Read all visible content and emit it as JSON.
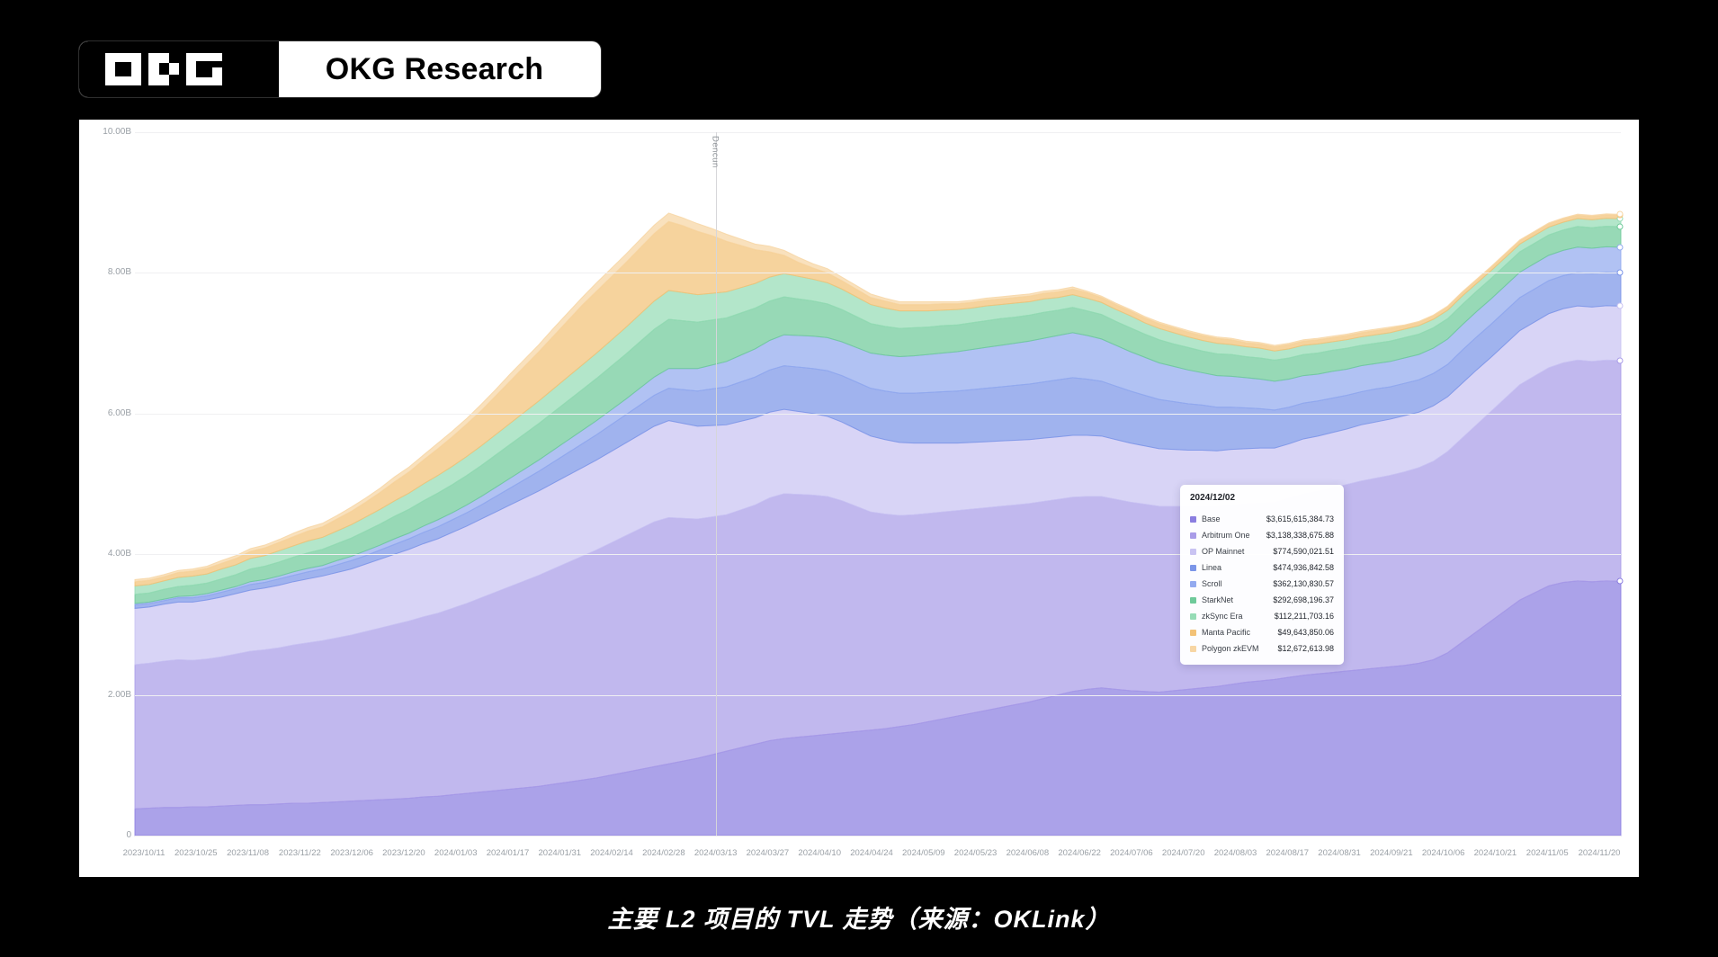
{
  "brand": {
    "logo_icon": "okg-logo-icon",
    "title": "OKG Research"
  },
  "caption": "主要 L2 项目的 TVL 走势（来源：OKLink）",
  "tooltip": {
    "date": "2024/12/02",
    "rows": [
      {
        "name": "Base",
        "value": "$3,615,615,384.73",
        "color": "#8b7ee0"
      },
      {
        "name": "Arbitrum One",
        "value": "$3,138,338,675.88",
        "color": "#a99ce8"
      },
      {
        "name": "OP Mainnet",
        "value": "$774,590,021.51",
        "color": "#c9c3f2"
      },
      {
        "name": "Linea",
        "value": "$474,936,842.58",
        "color": "#7b95e8"
      },
      {
        "name": "Scroll",
        "value": "$362,130,830.57",
        "color": "#93aaef"
      },
      {
        "name": "StarkNet",
        "value": "$292,698,196.37",
        "color": "#6fca9a"
      },
      {
        "name": "zkSync Era",
        "value": "$112,211,703.16",
        "color": "#96dcb6"
      },
      {
        "name": "Manta Pacific",
        "value": "$49,643,850.06",
        "color": "#f3c277"
      },
      {
        "name": "Polygon zkEVM",
        "value": "$12,672,613.98",
        "color": "#f7d6a4"
      }
    ]
  },
  "annotation": {
    "label": "Dencun"
  },
  "chart_data": {
    "type": "area",
    "stacked": true,
    "title": "",
    "xlabel": "",
    "ylabel": "",
    "ylim": [
      0,
      10000000000
    ],
    "grid": true,
    "legend_position": "tooltip",
    "y_ticks": [
      "0",
      "2.00B",
      "4.00B",
      "6.00B",
      "8.00B",
      "10.00B"
    ],
    "y_tick_values": [
      0,
      2000000000,
      4000000000,
      6000000000,
      8000000000,
      10000000000
    ],
    "x_ticks": [
      "2023/10/11",
      "2023/10/25",
      "2023/11/08",
      "2023/11/22",
      "2023/12/06",
      "2023/12/20",
      "2024/01/03",
      "2024/01/17",
      "2024/01/31",
      "2024/02/14",
      "2024/02/28",
      "2024/03/13",
      "2024/03/27",
      "2024/04/10",
      "2024/04/24",
      "2024/05/09",
      "2024/05/23",
      "2024/06/08",
      "2024/06/22",
      "2024/07/06",
      "2024/07/20",
      "2024/08/03",
      "2024/08/17",
      "2024/08/31",
      "2024/09/21",
      "2024/10/06",
      "2024/10/21",
      "2024/11/05",
      "2024/11/20"
    ],
    "annotations": [
      {
        "label": "Dencun",
        "x": "2024/03/13",
        "type": "vertical-line"
      }
    ],
    "series": [
      {
        "name": "Base",
        "color": "#8b7ee0",
        "values": [
          0.38,
          0.39,
          0.4,
          0.4,
          0.41,
          0.41,
          0.42,
          0.43,
          0.44,
          0.44,
          0.45,
          0.46,
          0.46,
          0.47,
          0.48,
          0.49,
          0.5,
          0.51,
          0.52,
          0.53,
          0.55,
          0.56,
          0.58,
          0.6,
          0.62,
          0.64,
          0.66,
          0.68,
          0.7,
          0.73,
          0.76,
          0.79,
          0.82,
          0.86,
          0.9,
          0.94,
          0.98,
          1.02,
          1.06,
          1.1,
          1.15,
          1.2,
          1.25,
          1.3,
          1.35,
          1.38,
          1.4,
          1.42,
          1.44,
          1.46,
          1.48,
          1.5,
          1.52,
          1.55,
          1.58,
          1.62,
          1.66,
          1.7,
          1.74,
          1.78,
          1.82,
          1.86,
          1.9,
          1.95,
          2.0,
          2.05,
          2.08,
          2.1,
          2.08,
          2.06,
          2.05,
          2.04,
          2.06,
          2.08,
          2.1,
          2.12,
          2.15,
          2.18,
          2.2,
          2.22,
          2.25,
          2.28,
          2.3,
          2.32,
          2.34,
          2.36,
          2.38,
          2.4,
          2.42,
          2.45,
          2.5,
          2.6,
          2.75,
          2.9,
          3.05,
          3.2,
          3.35,
          3.45,
          3.55,
          3.6,
          3.62,
          3.61,
          3.62,
          3.615
        ]
      },
      {
        "name": "Arbitrum One",
        "color": "#a99ce8",
        "values": [
          2.05,
          2.06,
          2.08,
          2.1,
          2.08,
          2.1,
          2.12,
          2.15,
          2.18,
          2.2,
          2.22,
          2.25,
          2.28,
          2.3,
          2.33,
          2.36,
          2.4,
          2.44,
          2.48,
          2.52,
          2.56,
          2.6,
          2.65,
          2.7,
          2.76,
          2.82,
          2.88,
          2.94,
          3.0,
          3.06,
          3.12,
          3.18,
          3.24,
          3.3,
          3.36,
          3.42,
          3.48,
          3.5,
          3.45,
          3.4,
          3.38,
          3.36,
          3.38,
          3.4,
          3.45,
          3.48,
          3.45,
          3.42,
          3.38,
          3.3,
          3.2,
          3.1,
          3.05,
          3.0,
          2.98,
          2.96,
          2.94,
          2.92,
          2.9,
          2.88,
          2.86,
          2.84,
          2.82,
          2.8,
          2.78,
          2.76,
          2.74,
          2.72,
          2.7,
          2.68,
          2.66,
          2.64,
          2.62,
          2.6,
          2.58,
          2.56,
          2.55,
          2.54,
          2.53,
          2.52,
          2.55,
          2.58,
          2.6,
          2.62,
          2.65,
          2.68,
          2.7,
          2.72,
          2.75,
          2.78,
          2.82,
          2.86,
          2.9,
          2.94,
          2.98,
          3.02,
          3.06,
          3.08,
          3.1,
          3.12,
          3.14,
          3.13,
          3.14,
          3.138
        ]
      },
      {
        "name": "OP Mainnet",
        "color": "#c9c3f2",
        "values": [
          0.8,
          0.8,
          0.81,
          0.82,
          0.83,
          0.84,
          0.85,
          0.86,
          0.87,
          0.88,
          0.89,
          0.9,
          0.91,
          0.92,
          0.93,
          0.94,
          0.96,
          0.98,
          1.0,
          1.02,
          1.04,
          1.06,
          1.08,
          1.1,
          1.12,
          1.14,
          1.16,
          1.18,
          1.2,
          1.22,
          1.24,
          1.26,
          1.28,
          1.3,
          1.32,
          1.34,
          1.36,
          1.38,
          1.35,
          1.32,
          1.3,
          1.28,
          1.26,
          1.24,
          1.22,
          1.2,
          1.18,
          1.16,
          1.14,
          1.12,
          1.1,
          1.08,
          1.06,
          1.04,
          1.02,
          1.0,
          0.98,
          0.96,
          0.95,
          0.94,
          0.93,
          0.92,
          0.91,
          0.9,
          0.89,
          0.88,
          0.87,
          0.86,
          0.85,
          0.84,
          0.83,
          0.82,
          0.81,
          0.8,
          0.8,
          0.79,
          0.79,
          0.78,
          0.78,
          0.77,
          0.77,
          0.78,
          0.78,
          0.79,
          0.79,
          0.8,
          0.8,
          0.8,
          0.8,
          0.79,
          0.79,
          0.78,
          0.78,
          0.78,
          0.77,
          0.77,
          0.77,
          0.77,
          0.77,
          0.77,
          0.77,
          0.775,
          0.774,
          0.7746
        ]
      },
      {
        "name": "Linea",
        "color": "#7b95e8",
        "values": [
          0.05,
          0.05,
          0.05,
          0.06,
          0.06,
          0.06,
          0.07,
          0.07,
          0.08,
          0.08,
          0.09,
          0.09,
          0.1,
          0.1,
          0.11,
          0.12,
          0.12,
          0.13,
          0.14,
          0.15,
          0.16,
          0.17,
          0.18,
          0.19,
          0.2,
          0.22,
          0.24,
          0.26,
          0.28,
          0.3,
          0.32,
          0.34,
          0.36,
          0.38,
          0.4,
          0.42,
          0.44,
          0.46,
          0.48,
          0.5,
          0.52,
          0.54,
          0.56,
          0.58,
          0.6,
          0.62,
          0.63,
          0.64,
          0.65,
          0.66,
          0.67,
          0.68,
          0.69,
          0.7,
          0.71,
          0.72,
          0.73,
          0.74,
          0.75,
          0.76,
          0.77,
          0.78,
          0.79,
          0.8,
          0.81,
          0.82,
          0.8,
          0.78,
          0.76,
          0.74,
          0.72,
          0.7,
          0.68,
          0.66,
          0.64,
          0.62,
          0.6,
          0.58,
          0.56,
          0.54,
          0.52,
          0.51,
          0.5,
          0.49,
          0.48,
          0.47,
          0.47,
          0.46,
          0.46,
          0.46,
          0.46,
          0.46,
          0.47,
          0.47,
          0.47,
          0.47,
          0.47,
          0.47,
          0.47,
          0.47,
          0.475,
          0.474,
          0.475,
          0.4749
        ]
      },
      {
        "name": "Scroll",
        "color": "#93aaef",
        "values": [
          0.02,
          0.02,
          0.02,
          0.02,
          0.03,
          0.03,
          0.03,
          0.03,
          0.04,
          0.04,
          0.04,
          0.05,
          0.05,
          0.05,
          0.06,
          0.06,
          0.07,
          0.07,
          0.08,
          0.08,
          0.09,
          0.1,
          0.1,
          0.11,
          0.12,
          0.13,
          0.14,
          0.15,
          0.16,
          0.17,
          0.18,
          0.19,
          0.2,
          0.21,
          0.22,
          0.24,
          0.26,
          0.28,
          0.3,
          0.32,
          0.34,
          0.36,
          0.38,
          0.4,
          0.42,
          0.44,
          0.45,
          0.46,
          0.47,
          0.48,
          0.49,
          0.5,
          0.51,
          0.52,
          0.53,
          0.54,
          0.55,
          0.56,
          0.57,
          0.58,
          0.59,
          0.6,
          0.61,
          0.62,
          0.63,
          0.64,
          0.62,
          0.6,
          0.58,
          0.56,
          0.54,
          0.52,
          0.5,
          0.48,
          0.46,
          0.45,
          0.44,
          0.43,
          0.42,
          0.41,
          0.4,
          0.39,
          0.38,
          0.38,
          0.37,
          0.37,
          0.36,
          0.36,
          0.36,
          0.36,
          0.36,
          0.36,
          0.36,
          0.36,
          0.36,
          0.36,
          0.36,
          0.36,
          0.36,
          0.36,
          0.362,
          0.362,
          0.362,
          0.3621
        ]
      },
      {
        "name": "StarkNet",
        "color": "#6fca9a",
        "values": [
          0.13,
          0.13,
          0.14,
          0.14,
          0.15,
          0.15,
          0.16,
          0.17,
          0.18,
          0.19,
          0.2,
          0.21,
          0.22,
          0.23,
          0.24,
          0.26,
          0.28,
          0.3,
          0.32,
          0.34,
          0.36,
          0.38,
          0.4,
          0.42,
          0.44,
          0.46,
          0.48,
          0.5,
          0.52,
          0.54,
          0.56,
          0.58,
          0.6,
          0.62,
          0.64,
          0.66,
          0.68,
          0.7,
          0.68,
          0.66,
          0.64,
          0.62,
          0.6,
          0.58,
          0.56,
          0.54,
          0.52,
          0.5,
          0.48,
          0.46,
          0.44,
          0.42,
          0.41,
          0.4,
          0.4,
          0.39,
          0.39,
          0.38,
          0.38,
          0.38,
          0.38,
          0.37,
          0.37,
          0.37,
          0.36,
          0.36,
          0.35,
          0.35,
          0.34,
          0.34,
          0.33,
          0.33,
          0.32,
          0.32,
          0.31,
          0.31,
          0.31,
          0.3,
          0.3,
          0.3,
          0.3,
          0.3,
          0.3,
          0.3,
          0.3,
          0.29,
          0.29,
          0.29,
          0.29,
          0.29,
          0.29,
          0.29,
          0.29,
          0.29,
          0.29,
          0.29,
          0.29,
          0.29,
          0.29,
          0.29,
          0.293,
          0.292,
          0.293,
          0.2927
        ]
      },
      {
        "name": "zkSync Era",
        "color": "#96dcb6",
        "values": [
          0.12,
          0.12,
          0.12,
          0.13,
          0.13,
          0.13,
          0.14,
          0.14,
          0.15,
          0.15,
          0.16,
          0.16,
          0.17,
          0.17,
          0.18,
          0.19,
          0.2,
          0.21,
          0.22,
          0.23,
          0.24,
          0.25,
          0.26,
          0.27,
          0.28,
          0.29,
          0.3,
          0.31,
          0.32,
          0.33,
          0.34,
          0.35,
          0.36,
          0.37,
          0.38,
          0.39,
          0.4,
          0.41,
          0.4,
          0.39,
          0.38,
          0.37,
          0.36,
          0.35,
          0.34,
          0.33,
          0.32,
          0.31,
          0.3,
          0.29,
          0.28,
          0.27,
          0.26,
          0.25,
          0.24,
          0.23,
          0.22,
          0.22,
          0.21,
          0.21,
          0.2,
          0.2,
          0.19,
          0.19,
          0.18,
          0.18,
          0.18,
          0.17,
          0.17,
          0.17,
          0.16,
          0.16,
          0.16,
          0.15,
          0.15,
          0.15,
          0.14,
          0.14,
          0.14,
          0.13,
          0.13,
          0.13,
          0.13,
          0.12,
          0.12,
          0.12,
          0.12,
          0.12,
          0.12,
          0.12,
          0.12,
          0.12,
          0.12,
          0.11,
          0.11,
          0.11,
          0.11,
          0.11,
          0.11,
          0.11,
          0.112,
          0.112,
          0.112,
          0.1122
        ]
      },
      {
        "name": "Manta Pacific",
        "color": "#f3c277",
        "values": [
          0.06,
          0.06,
          0.06,
          0.07,
          0.07,
          0.08,
          0.08,
          0.09,
          0.1,
          0.11,
          0.12,
          0.13,
          0.14,
          0.15,
          0.17,
          0.19,
          0.21,
          0.24,
          0.27,
          0.3,
          0.34,
          0.38,
          0.42,
          0.46,
          0.5,
          0.55,
          0.6,
          0.65,
          0.7,
          0.75,
          0.8,
          0.85,
          0.88,
          0.9,
          0.92,
          0.94,
          0.96,
          0.98,
          0.95,
          0.9,
          0.82,
          0.72,
          0.6,
          0.48,
          0.36,
          0.26,
          0.2,
          0.16,
          0.14,
          0.12,
          0.11,
          0.1,
          0.1,
          0.09,
          0.09,
          0.09,
          0.09,
          0.08,
          0.08,
          0.08,
          0.08,
          0.08,
          0.08,
          0.08,
          0.08,
          0.08,
          0.08,
          0.07,
          0.07,
          0.07,
          0.07,
          0.07,
          0.07,
          0.07,
          0.07,
          0.07,
          0.07,
          0.06,
          0.06,
          0.06,
          0.06,
          0.06,
          0.06,
          0.06,
          0.06,
          0.06,
          0.06,
          0.06,
          0.05,
          0.05,
          0.05,
          0.05,
          0.05,
          0.05,
          0.05,
          0.05,
          0.05,
          0.05,
          0.05,
          0.05,
          0.05,
          0.05,
          0.05,
          0.0496
        ]
      },
      {
        "name": "Polygon zkEVM",
        "color": "#f7d6a4",
        "values": [
          0.03,
          0.03,
          0.03,
          0.03,
          0.03,
          0.03,
          0.04,
          0.04,
          0.04,
          0.04,
          0.04,
          0.05,
          0.05,
          0.05,
          0.05,
          0.06,
          0.06,
          0.06,
          0.07,
          0.07,
          0.07,
          0.08,
          0.08,
          0.08,
          0.09,
          0.09,
          0.1,
          0.1,
          0.1,
          0.11,
          0.11,
          0.11,
          0.12,
          0.12,
          0.12,
          0.12,
          0.12,
          0.12,
          0.11,
          0.11,
          0.1,
          0.1,
          0.09,
          0.08,
          0.08,
          0.07,
          0.07,
          0.06,
          0.06,
          0.05,
          0.05,
          0.05,
          0.04,
          0.04,
          0.04,
          0.04,
          0.03,
          0.03,
          0.03,
          0.03,
          0.03,
          0.03,
          0.03,
          0.03,
          0.03,
          0.03,
          0.02,
          0.02,
          0.02,
          0.02,
          0.02,
          0.02,
          0.02,
          0.02,
          0.02,
          0.02,
          0.02,
          0.02,
          0.02,
          0.02,
          0.02,
          0.02,
          0.02,
          0.02,
          0.02,
          0.02,
          0.02,
          0.02,
          0.01,
          0.01,
          0.01,
          0.01,
          0.01,
          0.01,
          0.01,
          0.01,
          0.01,
          0.01,
          0.01,
          0.01,
          0.013,
          0.013,
          0.013,
          0.0127
        ]
      }
    ]
  }
}
